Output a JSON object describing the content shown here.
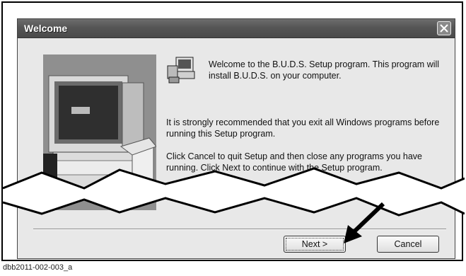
{
  "window": {
    "title": "Welcome",
    "close_icon": "close-icon"
  },
  "content": {
    "welcome_text": "Welcome to the B.U.D.S. Setup program.  This program will install B.U.D.S. on your computer.",
    "recommend_text": "It is strongly recommended that you exit all Windows programs before running this Setup program.",
    "instructions_text": "Click Cancel to quit Setup and then close any programs you have running.  Click Next to continue with the Setup program."
  },
  "buttons": {
    "next_label": "Next >",
    "cancel_label": "Cancel"
  },
  "caption": "dbb2011-002-003_a",
  "icons": {
    "illustration": "computer-illustration-icon",
    "setup": "setup-computer-icon",
    "callout": "arrow-pointer-icon"
  }
}
